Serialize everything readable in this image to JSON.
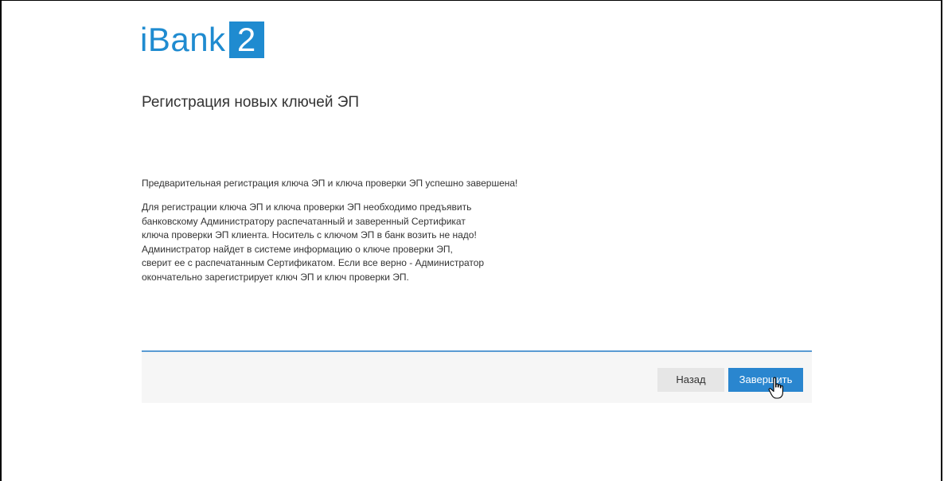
{
  "logo": {
    "text": "iBank",
    "number": "2"
  },
  "page": {
    "title": "Регистрация новых ключей ЭП",
    "success_message": "Предварительная регистрация ключа ЭП и ключа проверки ЭП успешно завершена!",
    "info_lines": [
      "Для регистрации ключа ЭП и ключа проверки ЭП необходимо предъявить",
      "банковскому Администратору распечатанный и заверенный Сертификат",
      "ключа проверки ЭП клиента. Носитель с ключом ЭП в банк возить не надо!",
      "Администратор найдет в системе информацию о ключе проверки ЭП,",
      "сверит ее с распечатанным Сертификатом. Если все верно - Администратор",
      "окончательно зарегистрирует ключ ЭП и ключ проверки ЭП."
    ]
  },
  "footer": {
    "back_label": "Назад",
    "finish_label": "Завершить"
  },
  "colors": {
    "brand": "#1f8bd0",
    "primary_button": "#2a86cf",
    "footer_border": "#5a9bd3"
  },
  "icons": {
    "cursor": "hand-pointer-icon"
  }
}
